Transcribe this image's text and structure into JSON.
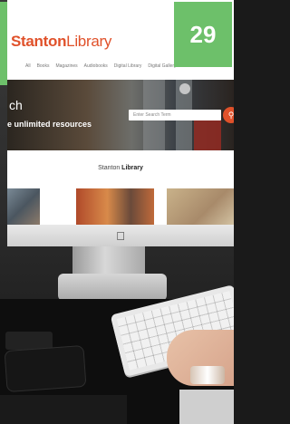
{
  "badge": {
    "number": "29",
    "color": "#6dc06a"
  },
  "website": {
    "logo": {
      "part1": "Stanton",
      "part2": "Library",
      "accent": "#e0512a"
    },
    "nav": [
      "All",
      "Books",
      "Magazines",
      "Audiobooks",
      "Digital Library",
      "Digital Gallery"
    ],
    "hero": {
      "title_fragment": "ch",
      "subtitle_fragment": "e unlimited resources",
      "search": {
        "placeholder": "Enter Search Term"
      }
    },
    "section": {
      "title_plain": "Stanton ",
      "title_bold": "Library"
    }
  },
  "icons": {
    "monitor_logo": "apple-icon",
    "search_button": "search-icon"
  }
}
